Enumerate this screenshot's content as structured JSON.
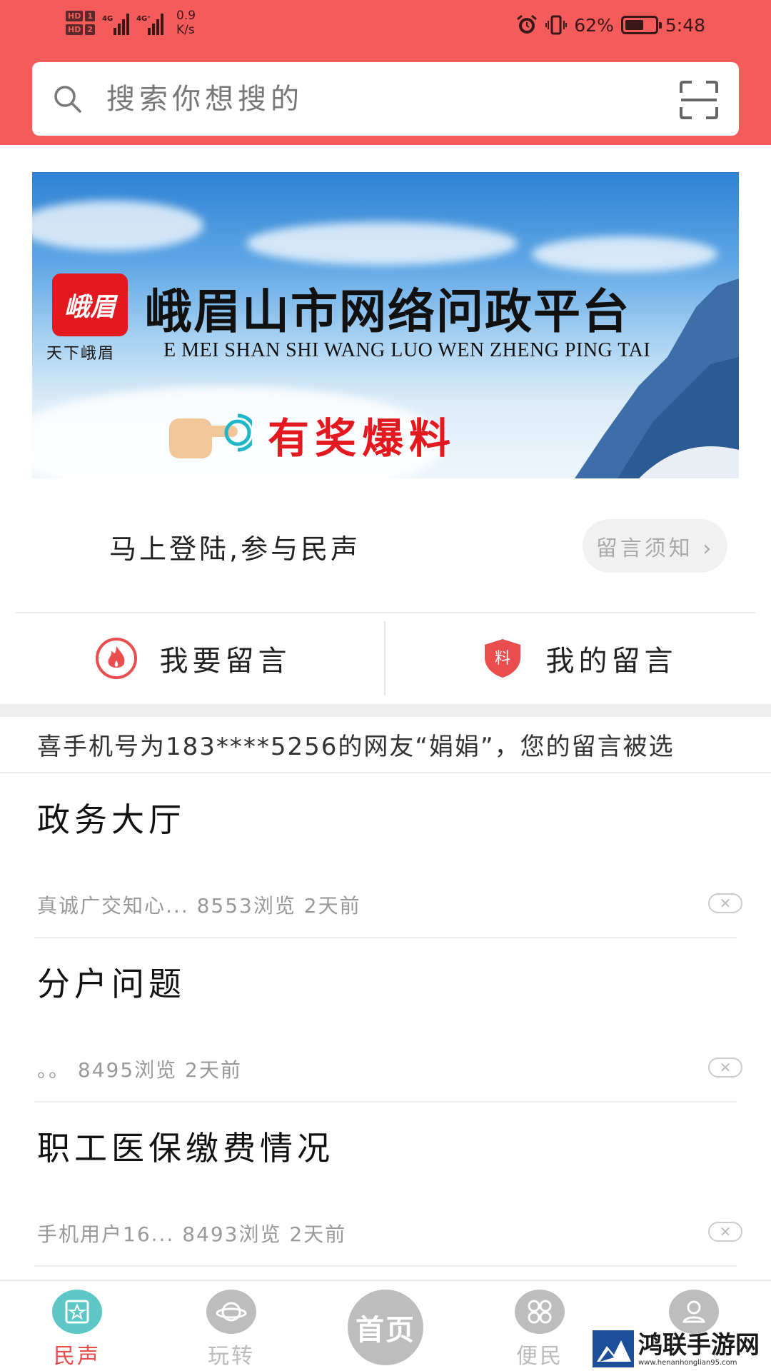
{
  "status_bar": {
    "hd1": "HD",
    "hd1_num": "1",
    "hd2": "HD",
    "hd2_num": "2",
    "net1": "4G",
    "net2": "4G⁺",
    "speed_value": "0.9",
    "speed_unit": "K/s",
    "battery": "62%",
    "battery_level": 0.62,
    "time": "5:48"
  },
  "search": {
    "placeholder": "搜索你想搜的"
  },
  "banner": {
    "logo_text": "峨眉",
    "logo_sub": "天下峨眉",
    "title": "峨眉山市网络问政平台",
    "subtitle": "E MEI SHAN SHI WANG LUO WEN ZHENG PING TAI",
    "cta": "有奖爆料"
  },
  "login": {
    "prompt": "马上登陆,参与民声",
    "notice_button": "留言须知 ›"
  },
  "actions": {
    "post": "我要留言",
    "mine": "我的留言",
    "mine_badge": "料"
  },
  "ticker": "喜手机号为183****5256的网友“娟娟”，您的留言被选",
  "feed": [
    {
      "title": "政务大厅",
      "meta": "真诚广交知心... 8553浏览  2天前"
    },
    {
      "title": "分户问题",
      "meta": "。。  8495浏览  2天前"
    },
    {
      "title": "职工医保缴费情况",
      "meta": "手机用户16... 8493浏览  2天前"
    }
  ],
  "nav": {
    "items": [
      "民声",
      "玩转",
      "便民"
    ],
    "home": "首页"
  },
  "watermark": {
    "name": "鸿联手游网",
    "url": "www.henanhonglian95.com"
  },
  "colors": {
    "header": "#f45b5b",
    "accent": "#e94d4d",
    "nav_active_icon": "#5cc7c4"
  }
}
